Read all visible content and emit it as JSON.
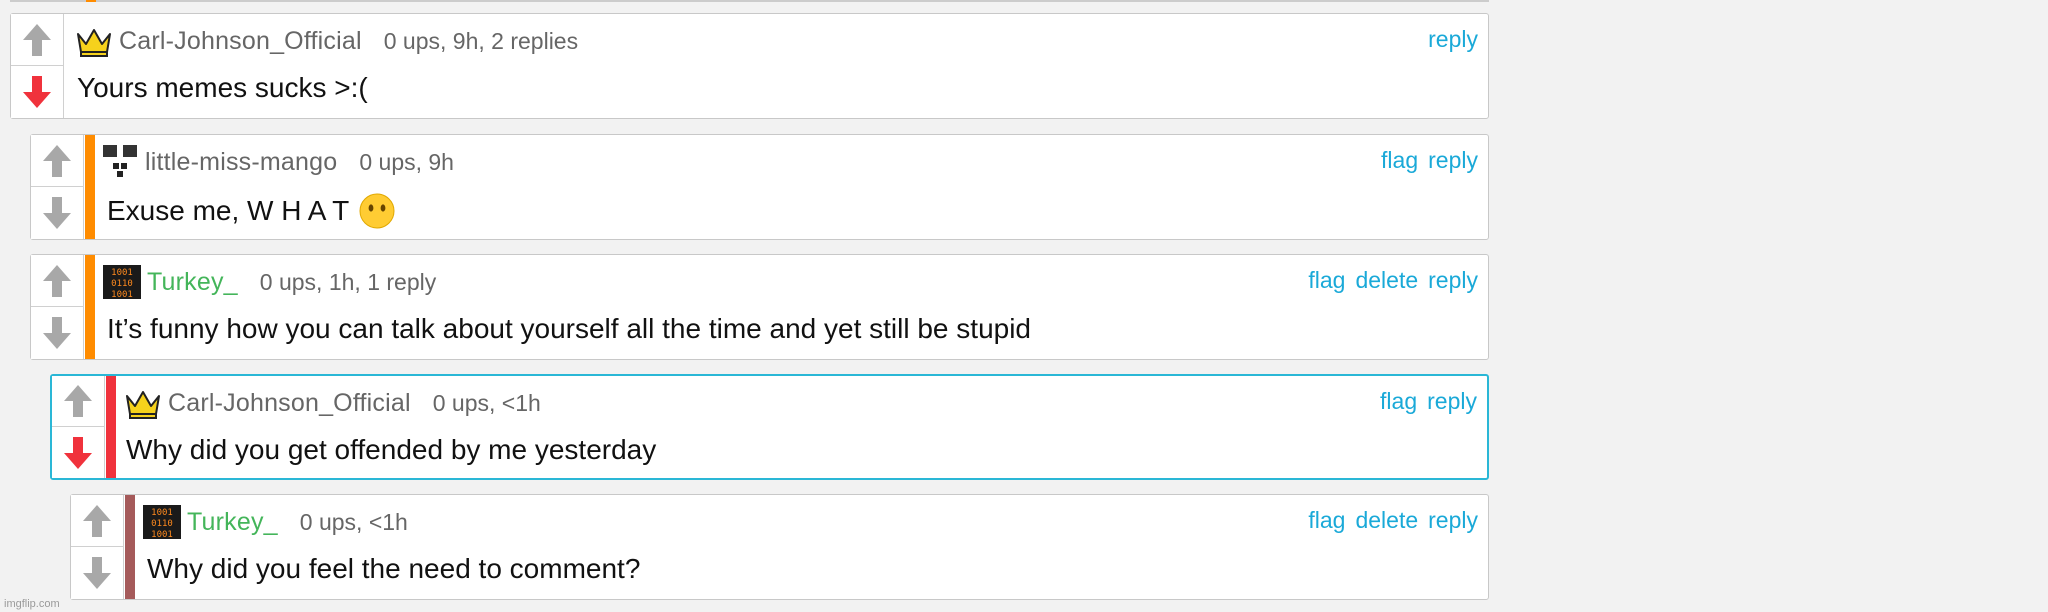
{
  "comments": [
    {
      "username": "Carl-Johnson_Official",
      "meta": "0 ups, 9h, 2 replies",
      "text": "Yours memes sucks >:(",
      "actions": [
        "reply"
      ],
      "vote_state": "downvoted",
      "bar_color": "",
      "avatar": "crown-icon",
      "active": false
    },
    {
      "username": "little-miss-mango",
      "meta": "0 ups, 9h",
      "text": "Exuse me, W H A T",
      "emoji": "no-mouth-face-emoji",
      "actions": [
        "flag",
        "reply"
      ],
      "vote_state": "none",
      "bar_color": "#ff8c00",
      "avatar": "pixel-face-icon",
      "active": false
    },
    {
      "username": "Turkey_",
      "meta": "0 ups, 1h, 1 reply",
      "text": "It’s funny how you can talk about yourself all the time and yet still be stupid",
      "actions": [
        "flag",
        "delete",
        "reply"
      ],
      "vote_state": "none",
      "bar_color": "#ff8c00",
      "avatar": "binary-icon",
      "active": false
    },
    {
      "username": "Carl-Johnson_Official",
      "meta": "0 ups, <1h",
      "text": "Why did you get offended by me yesterday",
      "actions": [
        "flag",
        "reply"
      ],
      "vote_state": "downvoted",
      "bar_color": "#f0323c",
      "avatar": "crown-icon",
      "active": true
    },
    {
      "username": "Turkey_",
      "meta": "0 ups, <1h",
      "text": "Why did you feel the need to comment?",
      "actions": [
        "flag",
        "delete",
        "reply"
      ],
      "vote_state": "none",
      "bar_color": "#a55a5a",
      "avatar": "binary-icon",
      "active": false
    }
  ],
  "watermark": "imgflip.com",
  "colors": {
    "link": "#1aa9d8",
    "green_user": "#44b55a",
    "downvote_active": "#f0323c",
    "vote_idle": "#a8a8a8",
    "active_border": "#2ab7d6"
  }
}
